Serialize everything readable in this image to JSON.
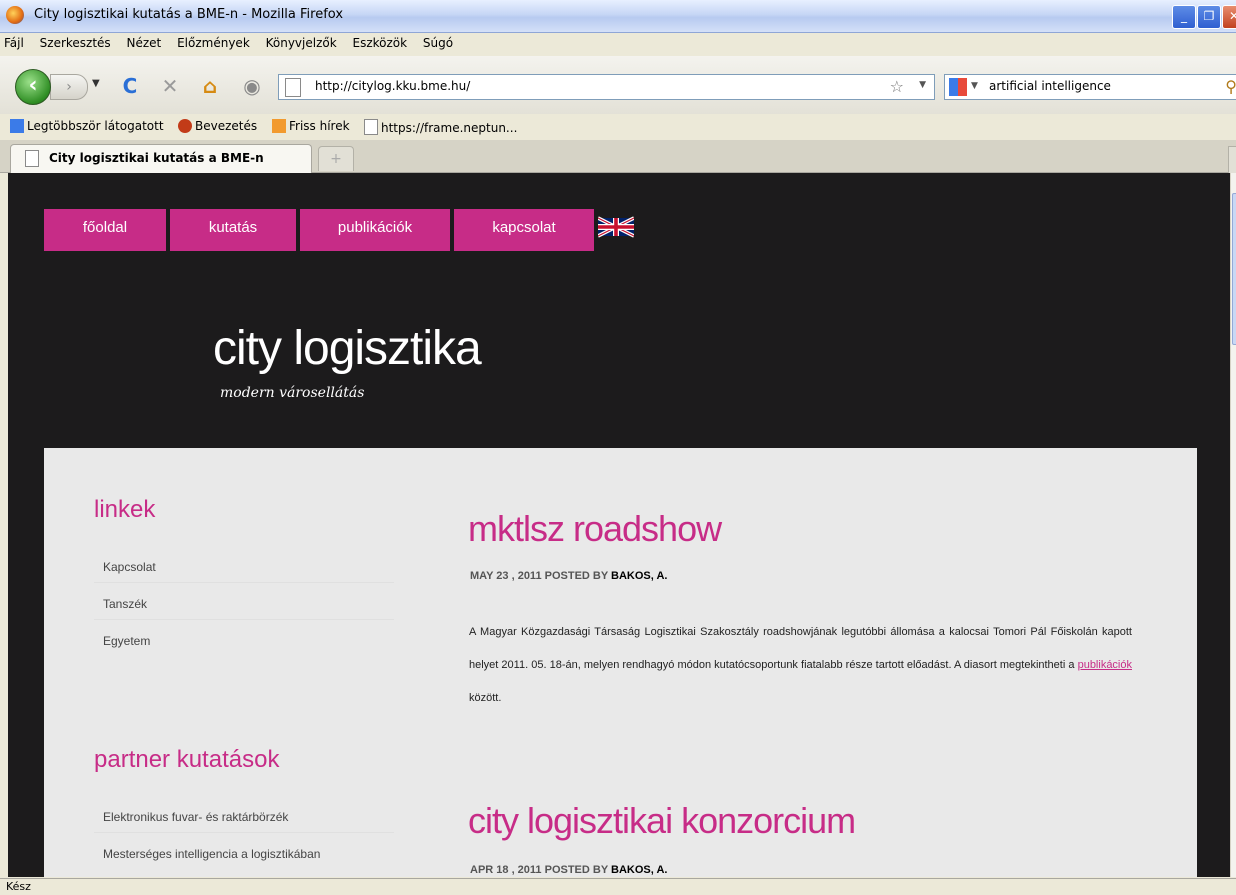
{
  "window": {
    "title": "City logisztikai kutatás a BME-n - Mozilla Firefox"
  },
  "menu": [
    "Fájl",
    "Szerkesztés",
    "Nézet",
    "Előzmények",
    "Könyvjelzők",
    "Eszközök",
    "Súgó"
  ],
  "toolbar": {
    "url": "http://citylog.kku.bme.hu/",
    "search_term": "artificial intelligence"
  },
  "bookmarks": [
    "Legtöbbször látogatott",
    "Bevezetés",
    "Friss hírek",
    "https://frame.neptun..."
  ],
  "tab": {
    "label": "City logisztikai kutatás a BME-n"
  },
  "site": {
    "nav": [
      "főoldal",
      "kutatás",
      "publikációk",
      "kapcsolat"
    ],
    "title": "city logisztika",
    "tagline": "modern városellátás"
  },
  "sidebar": {
    "links_heading": "linkek",
    "links": [
      "Kapcsolat",
      "Tanszék",
      "Egyetem"
    ],
    "partner_heading": "partner kutatások",
    "partner_links": [
      "Elektronikus fuvar- és raktárbörzék",
      "Mesterséges intelligencia a logisztikában"
    ]
  },
  "posts": [
    {
      "title": "mktlsz roadshow",
      "meta_date": "MAY 23 , 2011 POSTED BY",
      "meta_author": "BAKOS, A.",
      "body_before_link": "A Magyar Közgazdasági Társaság Logisztikai Szakosztály roadshowjának legutóbbi állomása a kalocsai Tomori Pál Főiskolán kapott helyet 2011. 05. 18-án, melyen rendhagyó módon kutatócsoportunk fiatalabb része tartott előadást. A diasort megtekintheti a",
      "link": "publikációk",
      "body_after_link": "között."
    },
    {
      "title": "city logisztikai konzorcium",
      "meta_date": "APR 18 , 2011 POSTED BY",
      "meta_author": "BAKOS, A."
    }
  ],
  "status": "Kész",
  "colors": {
    "accent": "#c72c87",
    "page_bg": "#1c1b1c",
    "panel_bg": "#e9e9e9"
  }
}
